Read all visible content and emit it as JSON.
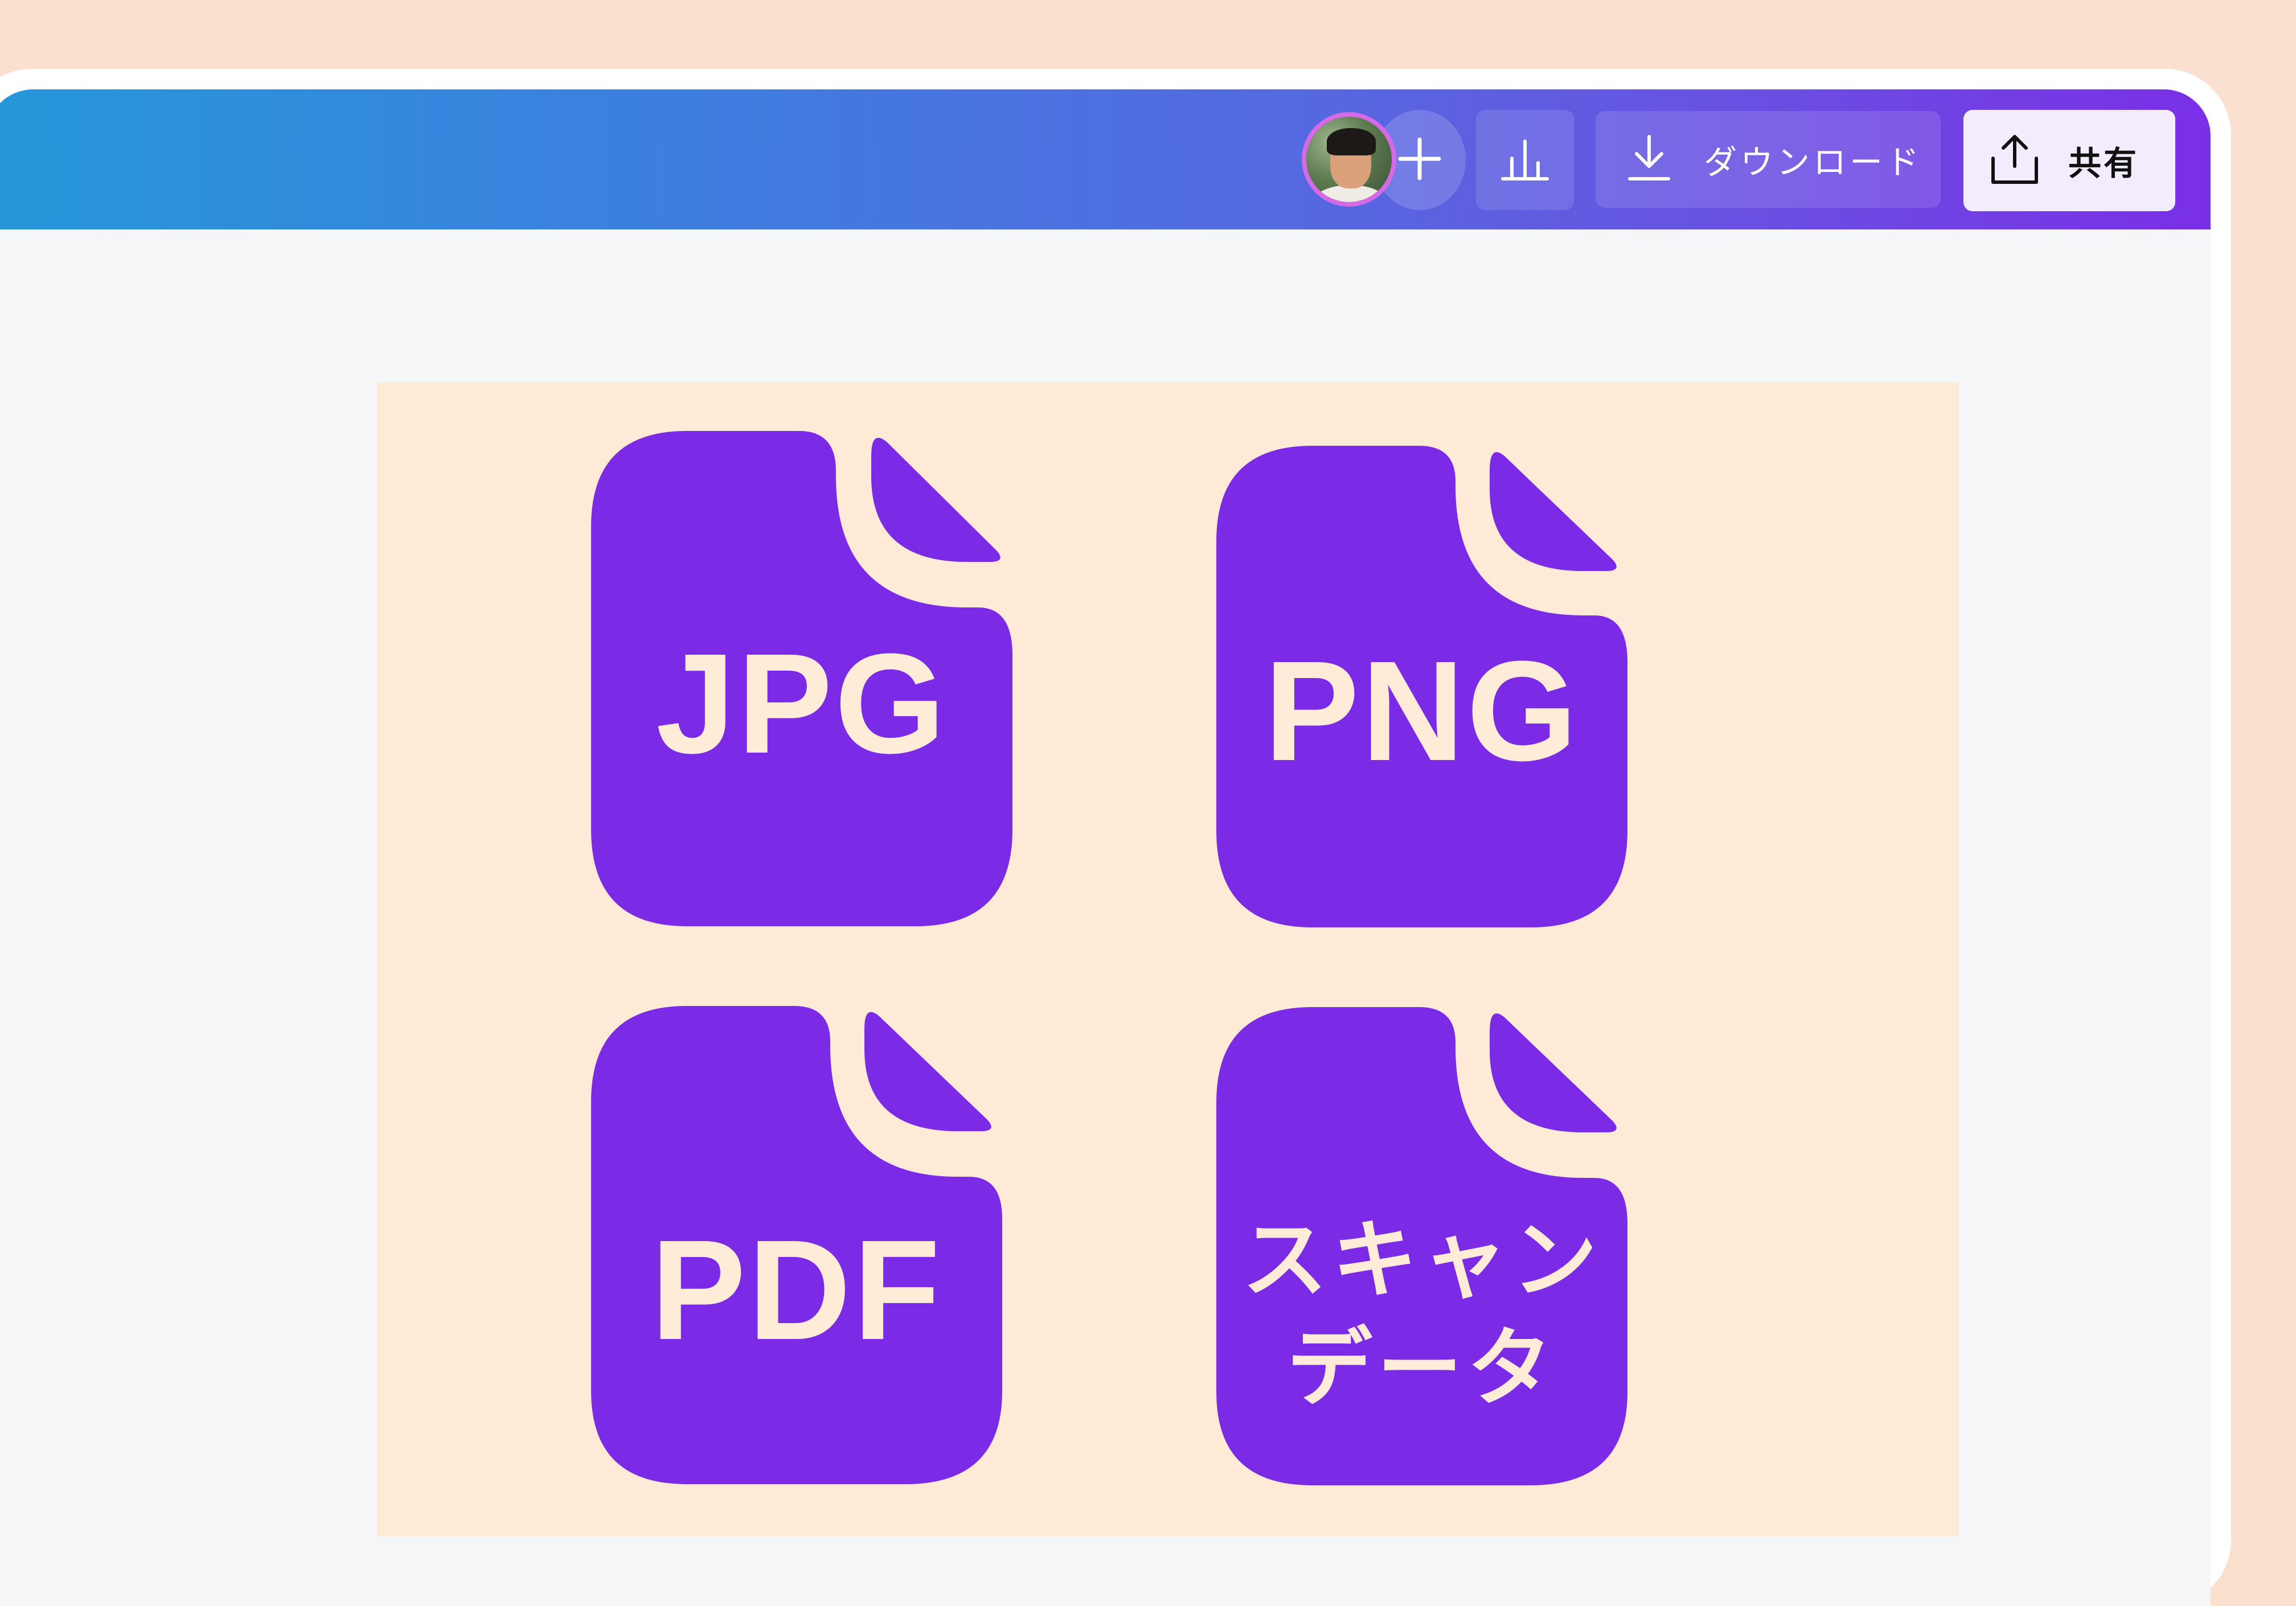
{
  "toolbar": {
    "add_icon": "plus-icon",
    "insights_icon": "bar-chart-icon",
    "download_icon": "download-icon",
    "download_label": "ダウンロード",
    "share_icon": "share-upload-icon",
    "share_label": "共有"
  },
  "colors": {
    "file_icon_fill": "#7b2ae6",
    "file_label": "#ffecd8",
    "design_background": "#ffe9d7",
    "share_button_background": "#f3ecfd"
  },
  "design": {
    "files": [
      {
        "label": "JPG"
      },
      {
        "label": "PNG"
      },
      {
        "label": "PDF"
      },
      {
        "label_line1": "スキャン",
        "label_line2": "データ"
      }
    ]
  }
}
